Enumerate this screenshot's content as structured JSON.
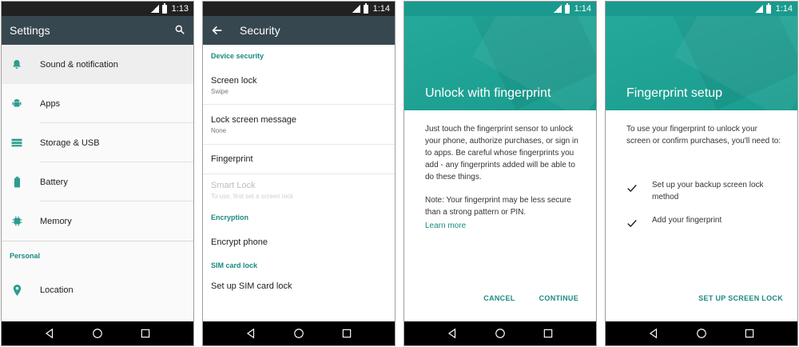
{
  "screen1": {
    "time": "1:13",
    "title": "Settings",
    "items": [
      {
        "label": "Sound & notification",
        "icon": "bell-icon"
      },
      {
        "label": "Apps",
        "icon": "android-icon"
      },
      {
        "label": "Storage & USB",
        "icon": "storage-icon"
      },
      {
        "label": "Battery",
        "icon": "battery-icon"
      },
      {
        "label": "Memory",
        "icon": "memory-icon"
      }
    ],
    "section": "Personal",
    "personal_items": [
      {
        "label": "Location",
        "icon": "location-icon"
      }
    ]
  },
  "screen2": {
    "time": "1:14",
    "title": "Security",
    "device_security_header": "Device security",
    "screen_lock": {
      "title": "Screen lock",
      "sub": "Swipe"
    },
    "lock_message": {
      "title": "Lock screen message",
      "sub": "None"
    },
    "fingerprint": "Fingerprint",
    "smart_lock": {
      "title": "Smart Lock",
      "sub": "To use, first set a screen lock"
    },
    "encryption_header": "Encryption",
    "encrypt_phone": "Encrypt phone",
    "sim_header": "SIM card lock",
    "sim_setup": "Set up SIM card lock"
  },
  "screen3": {
    "time": "1:14",
    "title": "Unlock with fingerprint",
    "para1": "Just touch the fingerprint sensor to unlock your phone, authorize purchases, or sign in to apps. Be careful whose fingerprints you add - any fingerprints added will be able to do these things.",
    "para2": "Note: Your fingerprint may be less secure than a strong pattern or PIN.",
    "learn_more": "Learn more",
    "cancel": "CANCEL",
    "continue": "CONTINUE"
  },
  "screen4": {
    "time": "1:14",
    "title": "Fingerprint setup",
    "intro": "To use your fingerprint to unlock your screen or confirm purchases, you'll need to:",
    "steps": [
      "Set up your backup screen lock method",
      "Add your fingerprint"
    ],
    "action": "SET UP SCREEN LOCK"
  },
  "colors": {
    "accent": "#1a8a80",
    "teal_hero": "#1fa394",
    "appbar": "#37474f"
  }
}
